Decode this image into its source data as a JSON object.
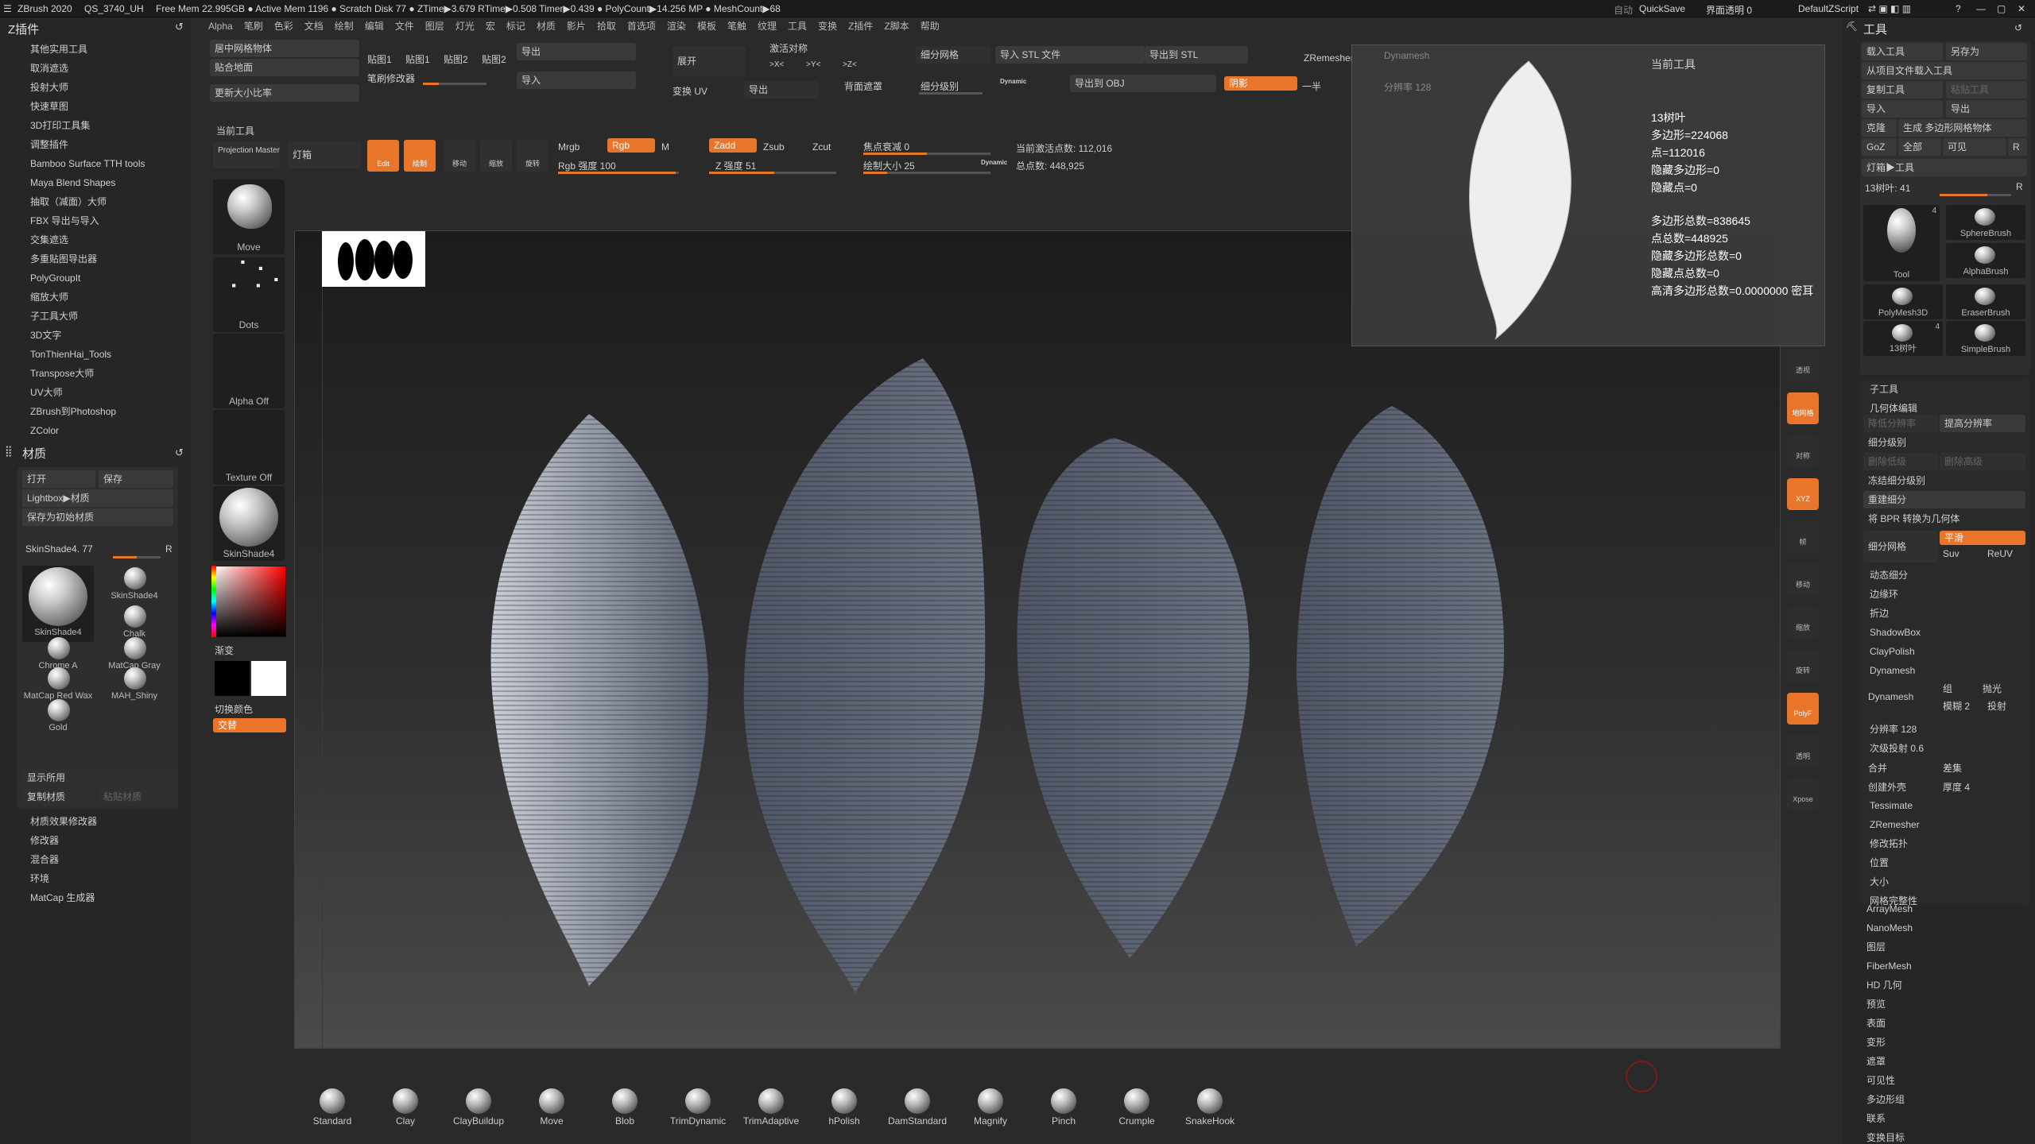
{
  "topbar": {
    "app": "ZBrush 2020",
    "project": "QS_3740_UH",
    "stats": "Free Mem 22.995GB ● Active Mem 1196 ● Scratch Disk 77 ● ZTime▶3.679 RTime▶0.508 Timer▶0.439 ● PolyCount▶14.256 MP ● MeshCount▶68",
    "auto": "自动",
    "quicksave": "QuickSave",
    "ui_transparency": "界面透明 0",
    "script": "DefaultZScript"
  },
  "menu": [
    "Alpha",
    "笔刷",
    "色彩",
    "文档",
    "绘制",
    "编辑",
    "文件",
    "图层",
    "灯光",
    "宏",
    "标记",
    "材质",
    "影片",
    "拾取",
    "首选项",
    "渲染",
    "模板",
    "笔触",
    "纹理",
    "工具",
    "变换",
    "Z插件",
    "Z脚本",
    "帮助"
  ],
  "left_plugins": {
    "header": "Z插件",
    "items": [
      "其他实用工具",
      "取消遮选",
      "投射大师",
      "快速草图",
      "3D打印工具集",
      "调整插件",
      "Bamboo Surface TTH tools",
      "Maya Blend Shapes",
      "抽取（减面）大师",
      "FBX 导出与导入",
      "交集遮选",
      "多重贴图导出器",
      "PolyGroupIt",
      "缩放大师",
      "子工具大师",
      "3D文字",
      "TonThienHai_Tools",
      "Transpose大师",
      "UV大师",
      "ZBrush到Photoshop",
      "ZColor"
    ]
  },
  "materials": {
    "header": "材质",
    "open": "打开",
    "save": "保存",
    "lightbox": "Lightbox▶材质",
    "save_startup": "保存为初始材质",
    "current": "SkinShade4. 77",
    "r": "R",
    "items": [
      "SkinShade4",
      "SkinShade4",
      "Chalk",
      "Chrome A",
      "MatCap Gray",
      "MatCap Red Wax",
      "MAH_Shiny",
      "Gold"
    ],
    "show_used": "显示所用",
    "copy": "复制材质",
    "paste": "粘贴材质",
    "bottom": [
      "材质效果修改器",
      "修改器",
      "混合器",
      "环境",
      "MatCap 生成器"
    ]
  },
  "shelf": {
    "row1": [
      "居中网格物体",
      "贴合地面",
      "更新大小比率"
    ],
    "maps": [
      "贴图1",
      "贴图1",
      "贴图2",
      "贴图2"
    ],
    "export": "导出",
    "import": "导入",
    "expand": "展开",
    "brush_mod": "笔刷修改器",
    "transform_uv": "变换 UV",
    "export2": "导出",
    "backface": "背面遮罩",
    "symmetry": "激活对称",
    "sym_x": ">X<",
    "sym_y": ">Y<",
    "sym_z": ">Z<",
    "divide": "细分网格",
    "sub_level": "细分级别",
    "dynamic": "Dynamic",
    "import_stl": "导入 STL 文件",
    "export_stl": "导出到 STL",
    "export_obj": "导出到 OBJ",
    "zremesher": "ZRemesher",
    "half": "一半",
    "shadow": "阴影",
    "dynamesh": "Dynamesh",
    "resolution": "分辨率 128",
    "current_tool": "当前工具"
  },
  "toolbar2": {
    "projection": "Projection Master",
    "lightbox": "灯箱",
    "edit": "Edit",
    "draw": "绘制",
    "move": "移动",
    "scale": "缩放",
    "rotate": "旋转",
    "mrgb": "Mrgb",
    "rgb": "Rgb",
    "m": "M",
    "zadd": "Zadd",
    "zsub": "Zsub",
    "zcut": "Zcut",
    "rgb_intensity": "Rgb 强度 100",
    "z_intensity": "Z 强度 51",
    "focal": "焦点衰减 0",
    "draw_size": "绘制大小 25",
    "dynamic": "Dynamic",
    "active_points": "当前激活点数: 112,016",
    "total_points": "总点数: 448,925"
  },
  "left_tools": {
    "move": "Move",
    "dots": "Dots",
    "alpha": "Alpha Off",
    "texture": "Texture Off",
    "material": "SkinShade4",
    "gradient": "渐变",
    "switch": "切换颜色",
    "alternate": "交替"
  },
  "info_popup": {
    "title": "当前工具",
    "lines": [
      "13树叶",
      "多边形=224068",
      "点=112016",
      "隐藏多边形=0",
      "隐藏点=0"
    ],
    "lines2": [
      "多边形总数=838645",
      "点总数=448925",
      "隐藏多边形总数=0",
      "隐藏点总数=0",
      "高清多边形总数=0.0000000 密耳"
    ]
  },
  "brushes": [
    "Standard",
    "Clay",
    "ClayBuildup",
    "Move",
    "Blob",
    "TrimDynamic",
    "TrimAdaptive",
    "hPolish",
    "DamStandard",
    "Magnify",
    "Pinch",
    "Crumple",
    "SnakeHook"
  ],
  "right_icons": [
    "透视",
    "地网格",
    "对称",
    "XYZ",
    "帧",
    "移动",
    "缩放",
    "旋转",
    "PolyF",
    "透明",
    "Xpose"
  ],
  "tool_panel": {
    "header": "工具",
    "load": "载入工具",
    "save_as": "另存为",
    "load_project": "从项目文件载入工具",
    "copy": "复制工具",
    "paste": "粘贴工具",
    "import": "导入",
    "export": "导出",
    "clone": "克隆",
    "make_poly": "生成 多边形网格物体",
    "goz": "GoZ",
    "all": "全部",
    "visible": "可见",
    "r": "R",
    "lightbox_tools": "灯箱▶工具",
    "current": "13树叶: 41",
    "thumbs": [
      {
        "label": "Tool",
        "n": "4"
      },
      {
        "label": "SphereBrush",
        "n": ""
      },
      {
        "label": "AlphaBrush",
        "n": ""
      },
      {
        "label": "PolyMesh3D",
        "n": ""
      },
      {
        "label": "EraserBrush",
        "n": ""
      },
      {
        "label": "13树叶",
        "n": "4"
      },
      {
        "label": "SimpleBrush",
        "n": ""
      }
    ],
    "subtool": "子工具",
    "geometry": "几何体编辑",
    "lower": "降低分辨率",
    "higher": "提高分辨率",
    "sdiv": "细分级别",
    "del_lower": "删除低级",
    "del_higher": "删除高级",
    "freeze": "冻结细分级别",
    "reconstruct": "重建细分",
    "convert_bpr": "将 BPR 转换为几何体",
    "divide": "细分网格",
    "smooth": "平滑",
    "suv": "Suv",
    "reuv": "ReUV",
    "dynamic_sub": "动态细分",
    "edge_loop": "边缘环",
    "crease": "折边",
    "shadowbox": "ShadowBox",
    "claypolish": "ClayPolish",
    "dynamesh": "Dynamesh",
    "group": "组",
    "polish": "抛光",
    "blur": "模糊 2",
    "project": "投射",
    "resolution": "分辨率 128",
    "sub_projection": "次级投射 0.6",
    "add": "合并",
    "sub": "差集",
    "create_shell": "创建外壳",
    "thickness": "厚度 4",
    "tessimate": "Tessimate",
    "zremesher": "ZRemesher",
    "modify_topo": "修改拓扑",
    "position": "位置",
    "size": "大小",
    "mesh_integrity": "网格完整性",
    "more": [
      "ArrayMesh",
      "NanoMesh",
      "图层",
      "FiberMesh",
      "HD 几何",
      "预览",
      "表面",
      "变形",
      "遮罩",
      "可见性",
      "多边形组",
      "联系",
      "变换目标"
    ]
  }
}
